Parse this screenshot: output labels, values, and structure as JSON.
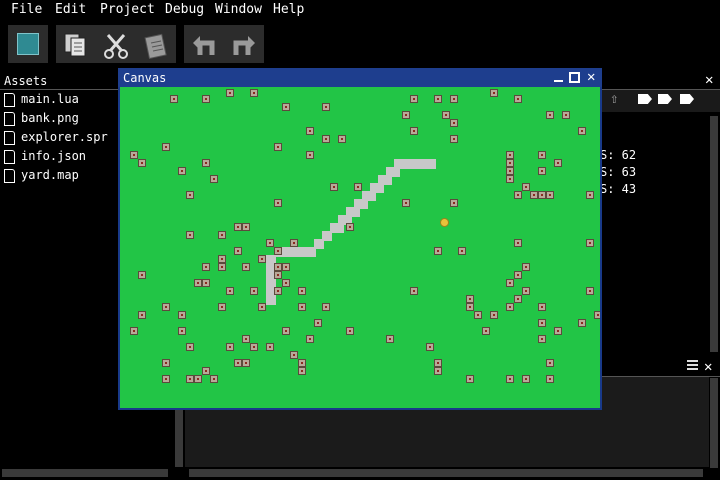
{
  "menu": [
    "File",
    "Edit",
    "Project",
    "Debug",
    "Window",
    "Help"
  ],
  "toolbar": {
    "colors": {
      "stop_square": "#2f8a92",
      "button_bg": "#2c2c2c",
      "icon_gray": "#9a9a9a"
    },
    "icons": [
      "stop-icon",
      "copy-icon",
      "cut-icon",
      "paste-icon",
      "undo-icon",
      "redo-icon"
    ]
  },
  "assets": {
    "title": "Assets",
    "files": [
      "main.lua",
      "bank.png",
      "explorer.spr",
      "info.json",
      "yard.map"
    ]
  },
  "canvas": {
    "title": "Canvas",
    "colors": {
      "title_bg": "#1e3e8e",
      "ground": "#22c546",
      "path": "#c8c8c8",
      "prop": "#b9a999",
      "sprite": "#e8c23a"
    }
  },
  "stats": [
    "S: 62",
    "S: 63",
    "S: 43"
  ],
  "colors": {
    "app_bg": "#000000",
    "panel_bg": "#111111",
    "border": "#444444",
    "text": "#ffffff"
  }
}
